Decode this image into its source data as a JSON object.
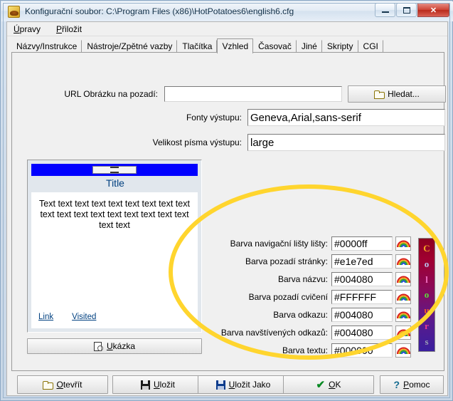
{
  "window": {
    "title": "Konfigurační soubor: C:\\Program Files (x86)\\HotPotatoes6\\english6.cfg",
    "icon": "hot-potatoes-icon",
    "minimize": "—",
    "maximize": "▢",
    "close": "✕"
  },
  "menu": {
    "items": [
      {
        "label": "Úpravy",
        "accel": "Ú"
      },
      {
        "label": "Přiložit",
        "accel": "P"
      }
    ]
  },
  "tabs": {
    "items": [
      {
        "label": "Názvy/Instrukce",
        "active": false
      },
      {
        "label": "Nástroje/Zpětné vazby",
        "active": false
      },
      {
        "label": "Tlačítka",
        "active": false
      },
      {
        "label": "Vzhled",
        "active": true
      },
      {
        "label": "Časovač",
        "active": false
      },
      {
        "label": "Jiné",
        "active": false
      },
      {
        "label": "Skripty",
        "active": false
      },
      {
        "label": "CGI",
        "active": false
      }
    ]
  },
  "form": {
    "url_label": "URL Obrázku na pozadí:",
    "url_value": "",
    "url_placeholder": "",
    "browse_label": "Hledat...",
    "browse_icon": "folder-open-icon",
    "fonts_label": "Fonty výstupu:",
    "fonts_value": "Geneva,Arial,sans-serif",
    "fontsize_label": "Velikost písma výstupu:",
    "fontsize_value": "large"
  },
  "preview": {
    "title": "Title",
    "body_text": "Text text text text text text text text text text text text text text text text text text text text",
    "link_label": "Link",
    "visited_label": "Visited",
    "nav_color": "#0000ff",
    "page_bg": "#e1e7ed",
    "title_color": "#004080",
    "exercise_bg": "#FFFFFF",
    "text_color": "#000000",
    "link_color": "#004080",
    "preview_button_label": "Ukázka",
    "preview_button_accel": "U",
    "preview_button_icon": "page-magnifier-icon"
  },
  "colours": {
    "rows": [
      {
        "label": "Barva navigační lišty lišty:",
        "value": "#0000ff",
        "icon": "rainbow-picker-icon"
      },
      {
        "label": "Barva pozadí stránky:",
        "value": "#e1e7ed",
        "icon": "rainbow-picker-icon"
      },
      {
        "label": "Barva názvu:",
        "value": "#004080",
        "icon": "rainbow-picker-icon"
      },
      {
        "label": "Barva pozadí cvičení",
        "value": "#FFFFFF",
        "icon": "rainbow-picker-icon"
      },
      {
        "label": "Barva odkazu:",
        "value": "#004080",
        "icon": "rainbow-picker-icon"
      },
      {
        "label": "Barva navštívených odkazů:",
        "value": "#004080",
        "icon": "rainbow-picker-icon"
      },
      {
        "label": "Barva textu:",
        "value": "#000000",
        "icon": "rainbow-picker-icon"
      }
    ],
    "banner_letters": [
      {
        "ch": "C",
        "color": "#f5a623"
      },
      {
        "ch": "o",
        "color": "#b9c6ef"
      },
      {
        "ch": "l",
        "color": "#f06ec0"
      },
      {
        "ch": "o",
        "color": "#5ede3a"
      },
      {
        "ch": "u",
        "color": "#f05a28"
      },
      {
        "ch": "r",
        "color": "#ef3b8e"
      },
      {
        "ch": "s",
        "color": "#9aa0b5"
      }
    ]
  },
  "footer": {
    "buttons": [
      {
        "label": "Otevřít",
        "accel": "O",
        "icon": "folder-open-icon"
      },
      {
        "label": "Uložit",
        "accel": "U",
        "icon": "floppy-disk-icon"
      },
      {
        "label": "Uložit Jako",
        "accel": "U",
        "icon": "floppy-disk-blue-icon"
      },
      {
        "label": "OK",
        "accel": "O",
        "icon": "green-check-icon"
      },
      {
        "label": "Pomoc",
        "accel": "P",
        "icon": "question-mark-icon"
      }
    ]
  },
  "annotation": {
    "shape": "ellipse",
    "color": "#ffd52e",
    "stroke_width": 6
  }
}
